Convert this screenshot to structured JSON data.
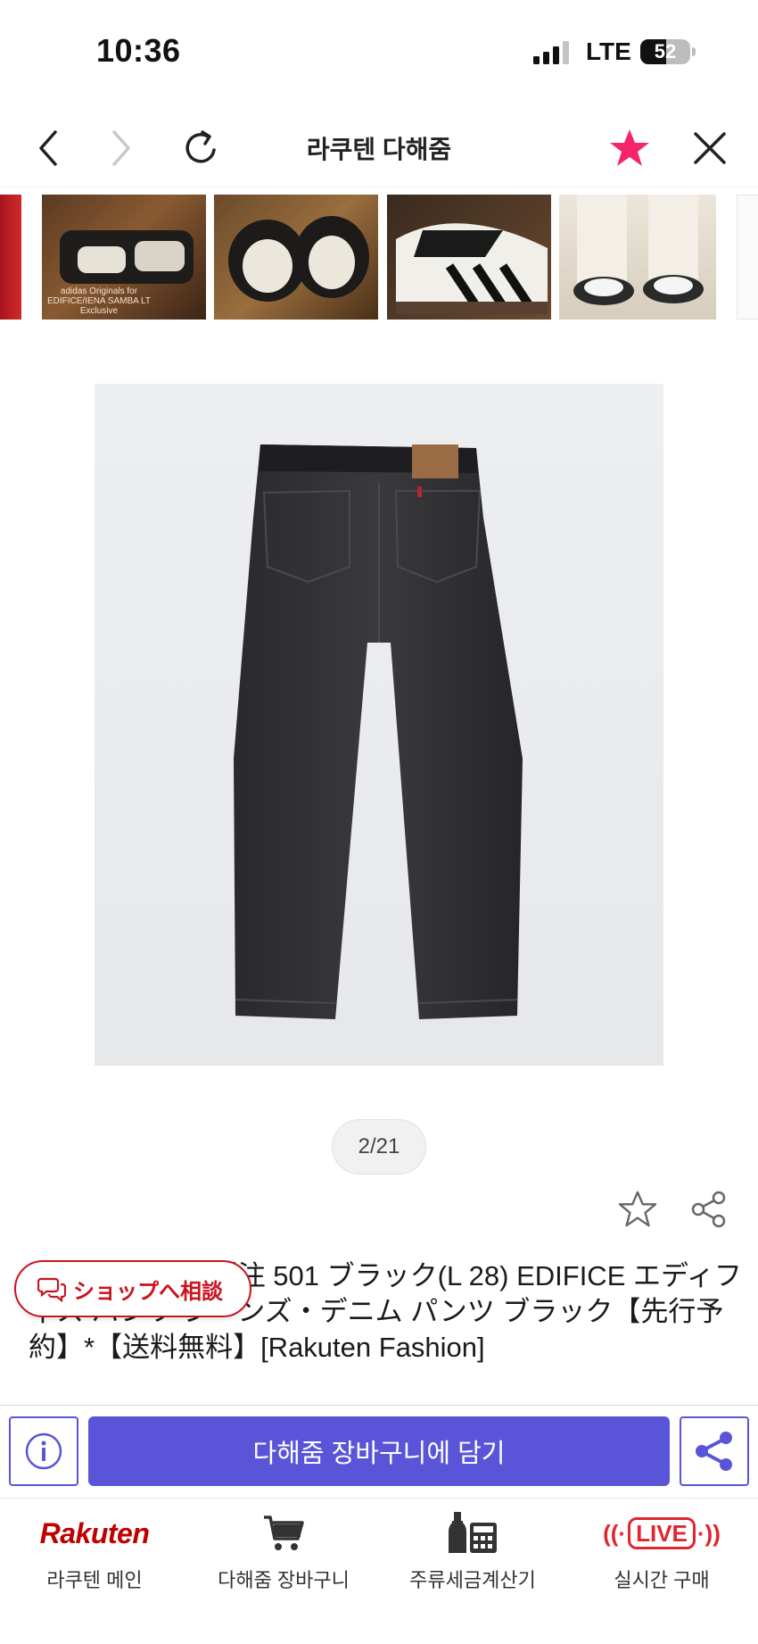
{
  "status_bar": {
    "time": "10:36",
    "network": "LTE",
    "battery_level": "52",
    "battery_fraction": 0.52,
    "signal_bars": 3
  },
  "browser_nav": {
    "title": "라쿠텐 다해줌",
    "icons": {
      "back": "chevron-left-icon",
      "forward": "chevron-right-icon",
      "reload": "reload-icon",
      "favorite": "star-filled-icon",
      "close": "close-icon"
    },
    "colors": {
      "favorite": "#f5246b",
      "disabled": "#c8c8c8"
    }
  },
  "thumbnails": [
    {
      "caption": ""
    },
    {
      "caption": "adidas Originals for EDIFICE/IENA SAMBA LT Exclusive"
    },
    {
      "caption": ""
    },
    {
      "caption": ""
    },
    {
      "caption": ""
    }
  ],
  "gallery": {
    "counter": "2/21",
    "current_index": 2,
    "total": 21
  },
  "product": {
    "title": "R)/リーバイス 別注 501 ブラック(L 28) EDIFICE エディフィス パンツ ジーンズ・デニム パンツ ブラック【先行予約】*【送料無料】[Rakuten Fashion]",
    "favorite_icon": "star-outline-icon",
    "share_icon": "share-icon"
  },
  "consult_button": {
    "label": "ショップへ相談",
    "icon": "chat-bubbles-icon",
    "color": "#c9141f"
  },
  "action_bar": {
    "info_icon": "info-icon",
    "add_to_cart_label": "다해줌 장바구니에 담기",
    "share_icon": "share-icon",
    "accent": "#5a55d8"
  },
  "tab_bar": {
    "items": [
      {
        "logo": "Rakuten",
        "label": "라쿠텐 메인"
      },
      {
        "icon": "cart-icon",
        "label": "다해줌 장바구니"
      },
      {
        "icon": "liquor-calculator-icon",
        "label": "주류세금계산기"
      },
      {
        "logo": "LIVE",
        "label": "실시간 구매"
      }
    ]
  }
}
